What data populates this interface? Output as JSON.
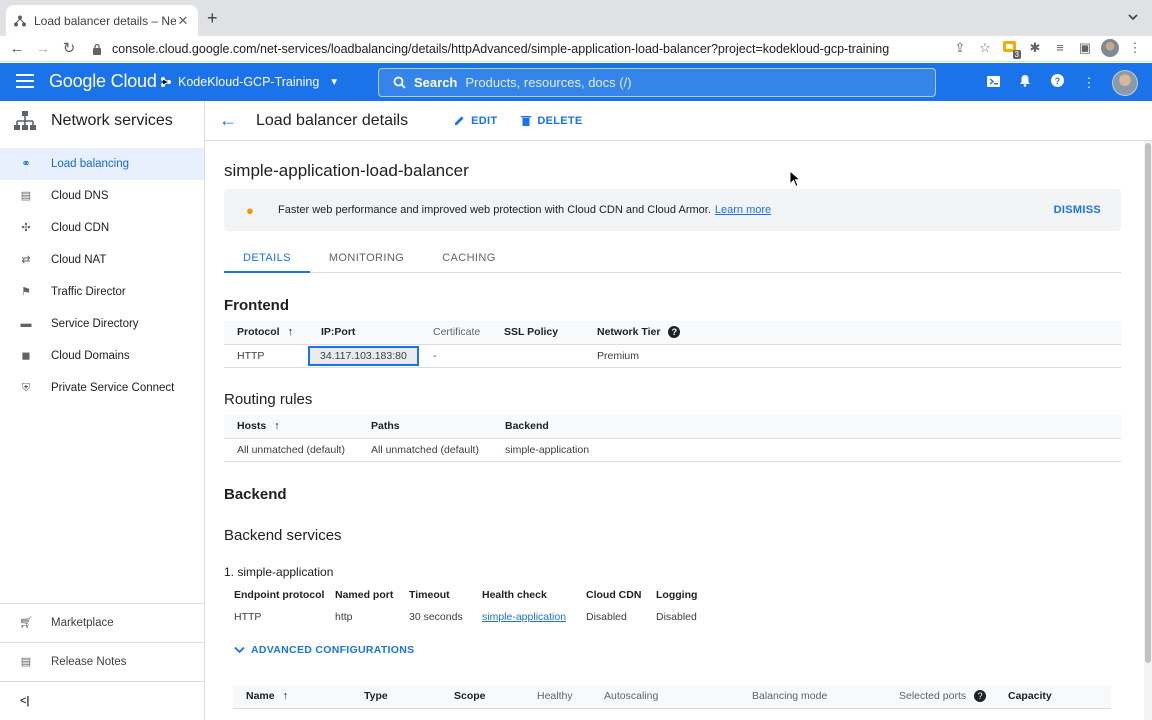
{
  "browser": {
    "tab_title": "Load balancer details – Netwo",
    "url": "console.cloud.google.com/net-services/loadbalancing/details/httpAdvanced/simple-application-load-balancer?project=kodekloud-gcp-training",
    "extension_badge": "3"
  },
  "header": {
    "logo": "Google Cloud",
    "project": "KodeKloud-GCP-Training",
    "search_label": "Search",
    "search_placeholder": "Products, resources, docs (/)"
  },
  "sidebar": {
    "title": "Network services",
    "items": [
      {
        "label": "Load balancing",
        "icon": "load-balancing-icon"
      },
      {
        "label": "Cloud DNS",
        "icon": "dns-icon"
      },
      {
        "label": "Cloud CDN",
        "icon": "cdn-icon"
      },
      {
        "label": "Cloud NAT",
        "icon": "nat-icon"
      },
      {
        "label": "Traffic Director",
        "icon": "traffic-director-icon"
      },
      {
        "label": "Service Directory",
        "icon": "service-directory-icon"
      },
      {
        "label": "Cloud Domains",
        "icon": "domains-icon"
      },
      {
        "label": "Private Service Connect",
        "icon": "private-service-connect-icon"
      }
    ],
    "marketplace": "Marketplace",
    "release_notes": "Release Notes"
  },
  "topbar": {
    "title": "Load balancer details",
    "edit": "EDIT",
    "delete": "DELETE"
  },
  "lb_name": "simple-application-load-balancer",
  "banner": {
    "text": "Faster web performance and improved web protection with Cloud CDN and Cloud Armor.",
    "learn_more": "Learn more",
    "dismiss": "DISMISS"
  },
  "tabs": [
    "DETAILS",
    "MONITORING",
    "CACHING"
  ],
  "frontend": {
    "title": "Frontend",
    "headers": [
      "Protocol",
      "IP:Port",
      "Certificate",
      "SSL Policy",
      "Network Tier"
    ],
    "row": [
      "HTTP",
      "34.117.103.183:80",
      "-",
      "",
      "Premium"
    ]
  },
  "routing": {
    "title": "Routing rules",
    "headers": [
      "Hosts",
      "Paths",
      "Backend"
    ],
    "row": [
      "All unmatched (default)",
      "All unmatched (default)",
      "simple-application"
    ]
  },
  "backend": {
    "title": "Backend",
    "services_title": "Backend services",
    "service_name": "1. simple-application",
    "fields": [
      {
        "k": "Endpoint protocol",
        "v": "HTTP"
      },
      {
        "k": "Named port",
        "v": "http"
      },
      {
        "k": "Timeout",
        "v": "30 seconds"
      },
      {
        "k": "Health check",
        "v": "simple-application"
      },
      {
        "k": "Cloud CDN",
        "v": "Disabled"
      },
      {
        "k": "Logging",
        "v": "Disabled"
      }
    ],
    "advanced": "ADVANCED CONFIGURATIONS",
    "table_headers": [
      "Name",
      "Type",
      "Scope",
      "Healthy",
      "Autoscaling",
      "Balancing mode",
      "Selected ports",
      "Capacity"
    ]
  }
}
